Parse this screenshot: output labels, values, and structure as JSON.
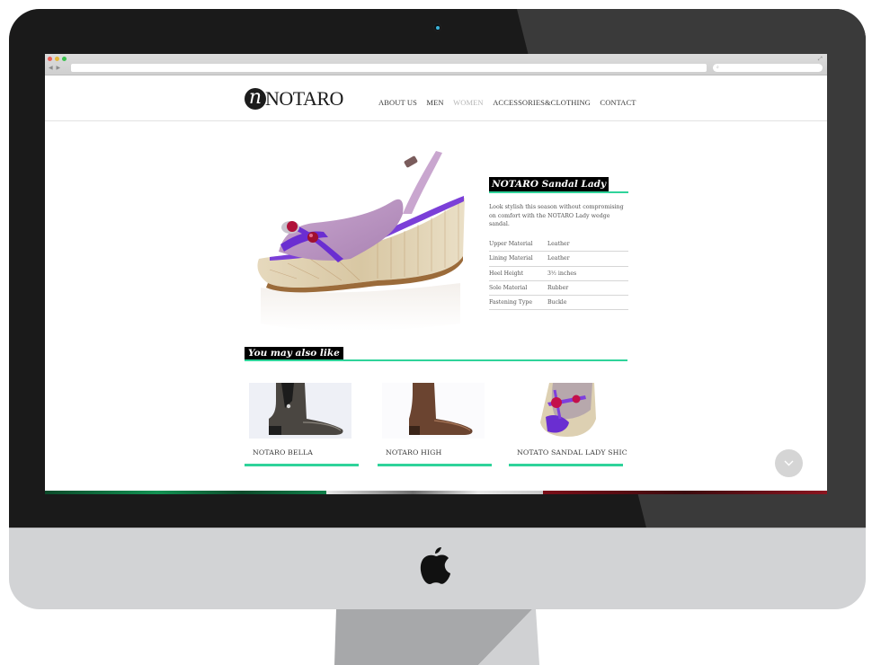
{
  "device": {
    "type": "desktop-monitor",
    "logo": "apple-logo"
  },
  "browser": {
    "url_placeholder": "",
    "search_placeholder": "",
    "traffic_lights": [
      "close",
      "minimize",
      "zoom"
    ],
    "colors": {
      "close": "#ec5f58",
      "minimize": "#e5b83a",
      "zoom": "#3bc24f"
    }
  },
  "site": {
    "brand": {
      "mark": "n",
      "name": "NOTARO"
    },
    "nav": [
      {
        "label": "ABOUT US",
        "active": false
      },
      {
        "label": "MEN",
        "active": false
      },
      {
        "label": "WOMEN",
        "active": true
      },
      {
        "label": "ACCESSORIES&CLOTHING",
        "active": false
      },
      {
        "label": "CONTACT",
        "active": false
      }
    ],
    "accent_color": "#2fd39a"
  },
  "product": {
    "title": "NOTARO Sandal Lady",
    "description": "Look stylish this season without compromising on comfort with the NOTARO Lady wedge sandal.",
    "image": "purple-wedge-sandal",
    "specs": [
      {
        "label": "Upper Material",
        "value": "Leather"
      },
      {
        "label": "Lining Material",
        "value": "Leather"
      },
      {
        "label": "Heel Height",
        "value": "3½ inches"
      },
      {
        "label": "Sole Material",
        "value": "Rubber"
      },
      {
        "label": "Fastening Type",
        "value": "Buckle"
      }
    ]
  },
  "related": {
    "title": "You may also like",
    "items": [
      {
        "name": "NOTARO BELLA",
        "image": "dark-grey-ankle-boot"
      },
      {
        "name": "NOTARO HIGH",
        "image": "brown-ankle-boot"
      },
      {
        "name": "NOTATO SANDAL LADY SHIC",
        "image": "purple-sandal-closeup"
      }
    ]
  },
  "scroll_button": {
    "icon": "chevron-down-icon"
  },
  "footer_strip": {
    "colors": [
      "#129152",
      "#e8e8e8",
      "#8a1520"
    ]
  }
}
